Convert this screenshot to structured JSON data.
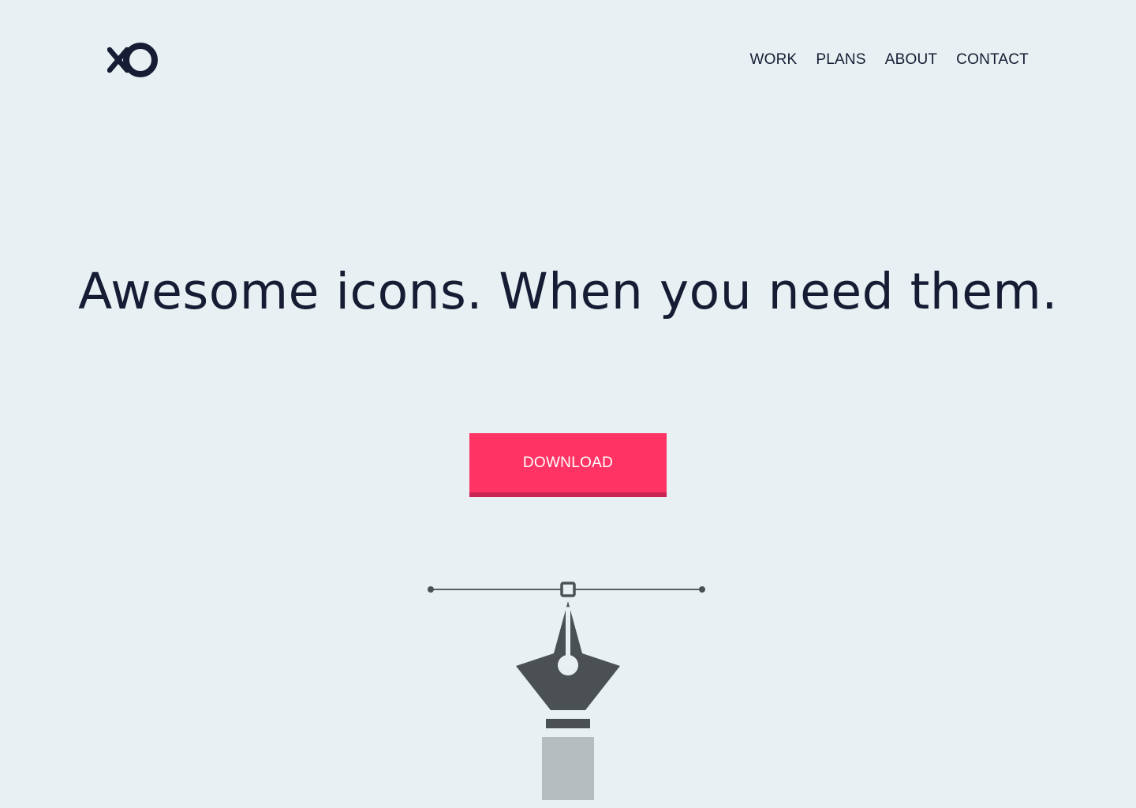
{
  "header": {
    "logo_icon": "xo-logo-icon",
    "nav": [
      {
        "label": "WORK"
      },
      {
        "label": "PLANS"
      },
      {
        "label": "ABOUT"
      },
      {
        "label": "CONTACT"
      }
    ]
  },
  "hero": {
    "headline": "Awesome icons. When you need them.",
    "download_label": "DOWNLOAD",
    "illustration_icon": "pen-tool-icon"
  },
  "colors": {
    "background": "#e8f0f3",
    "text": "#151c33",
    "accent": "#ff3464",
    "accent_shadow": "#c92452",
    "pen_dark": "#4a5054",
    "pen_light": "#b5bdbf"
  }
}
